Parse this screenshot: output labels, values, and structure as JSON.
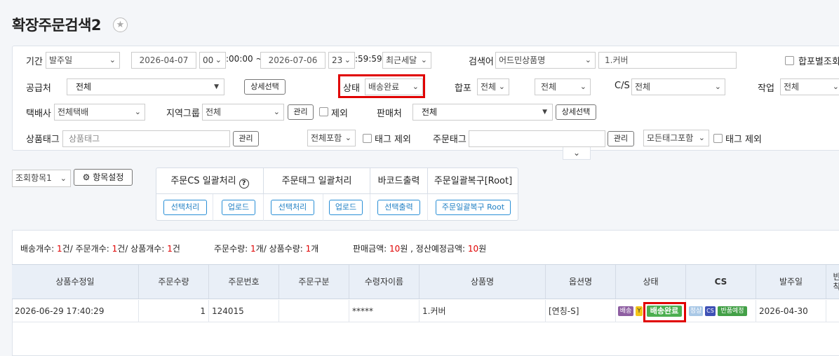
{
  "page": {
    "title": "확장주문검색2"
  },
  "filters": {
    "period_label": "기간",
    "period_type": "발주일",
    "date_from": "2026-04-07",
    "hour_from": "00",
    "time_from_rest": ":00:00 ~",
    "date_to": "2026-07-06",
    "hour_to": "23",
    "time_to_rest": ":59:59",
    "quick_range": "최근세달",
    "keyword_label": "검색어",
    "keyword_type": "어드민상품명",
    "keyword_value": "1.커버",
    "merge_search_label": "합포별조회",
    "supplier_label": "공급처",
    "supplier_value": "전체",
    "detail_select_label": "상세선택",
    "status_label": "상태",
    "status_value": "배송완료",
    "merge_label": "합포",
    "merge_value1": "전체",
    "merge_value2": "전체",
    "cs_label": "C/S",
    "cs_value": "전체",
    "work_label": "작업",
    "work_value": "전체",
    "courier_label": "택배사",
    "courier_value": "전체택배",
    "region_label": "지역그룹",
    "region_value": "전체",
    "manage_label": "관리",
    "exclude_label": "제외",
    "seller_label": "판매처",
    "seller_value": "전체",
    "seller_detail_label": "상세선택",
    "product_tag_label": "상품태그",
    "product_tag_placeholder": "상품태그",
    "product_tag_manage": "관리",
    "tag_include_value": "전체포함",
    "tag_exclude_label": "태그 제외",
    "order_tag_label": "주문태그",
    "order_tag_manage": "관리",
    "order_tag_include_value": "모든태그포함",
    "order_tag_exclude_label": "태그 제외"
  },
  "toolbar": {
    "view_select": "조회항목1",
    "settings_label": "항목설정"
  },
  "bulk": {
    "cs_title": "주문CS 일괄처리",
    "cs_select": "선택처리",
    "cs_upload": "업로드",
    "tag_title": "주문태그 일괄처리",
    "tag_select": "선택처리",
    "tag_upload": "업로드",
    "barcode_title": "바코드출력",
    "barcode_btn": "선택출력",
    "restore_title": "주문일괄복구[Root]",
    "restore_btn": "주문일괄복구 Root"
  },
  "summary": {
    "ship_label": "배송개수: ",
    "ship_count": "1",
    "ship_unit": "건/ ",
    "order_label": "주문개수: ",
    "order_count": "1",
    "order_unit": "건/ ",
    "prod_label": "상품개수: ",
    "prod_count": "1",
    "prod_unit": "건",
    "order_qty_label": "주문수량: ",
    "order_qty": "1",
    "order_qty_unit": "개/ ",
    "prod_qty_label": "상품수량: ",
    "prod_qty": "1",
    "prod_qty_unit": "개",
    "sales_label": "판매금액: ",
    "sales": "10",
    "sales_unit": "원 , ",
    "settle_label": "정산예정금액: ",
    "settle": "10",
    "settle_unit": "원"
  },
  "table": {
    "columns": [
      "상품수정일",
      "주문수량",
      "주문번호",
      "주문구분",
      "수령자이름",
      "상품명",
      "옵션명",
      "상태",
      "CS",
      "발주일",
      "반",
      "착"
    ],
    "row": {
      "modified": "2026-06-29 17:40:29",
      "qty": "1",
      "order_no": "124015",
      "order_type": "",
      "recipient": "*****",
      "product": "1.커버",
      "option": "[연칭-S]",
      "status_tag1": "배송",
      "status_tag2": "Y",
      "status_main": "배송완료",
      "cs_tag1": "정상",
      "cs_tag2": "CS",
      "cs_tag3": "반품예정",
      "order_date": "2026-04-30"
    }
  },
  "colors": {
    "accent_blue": "#2a8fd6",
    "highlight_red": "#e00000",
    "status_green": "#4caf50",
    "tag_purple": "#8e5ea2"
  }
}
